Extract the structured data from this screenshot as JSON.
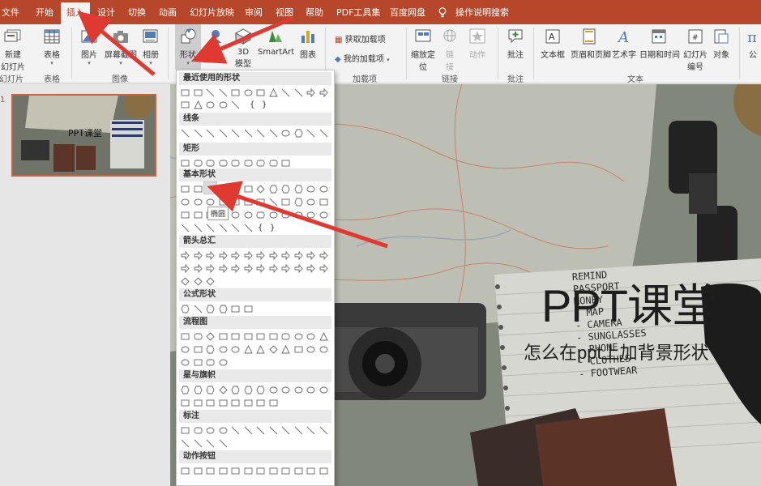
{
  "tabs": [
    "文件",
    "开始",
    "插入",
    "设计",
    "切换",
    "动画",
    "幻灯片放映",
    "审阅",
    "视图",
    "帮助",
    "PDF工具集",
    "百度网盘"
  ],
  "active_tab": "插入",
  "tell_me": "操作说明搜索",
  "ribbon": {
    "new_slide": "新建",
    "new_slide_2": "幻灯片",
    "table": "表格",
    "picture": "图片",
    "screenshot": "屏幕截图",
    "album": "相册",
    "shapes": "形状",
    "icons": "标",
    "model3d": "3D",
    "model3d_2": "模型",
    "smartart": "SmartArt",
    "chart": "图表",
    "get_addins": "获取加载项",
    "my_addins": "我的加载项",
    "zoom": "缩放定",
    "zoom_2": "位",
    "link": "链",
    "link_2": "接",
    "action": "动作",
    "comment": "批注",
    "textbox": "文本框",
    "header_footer": "页眉和页脚",
    "wordart": "艺术字",
    "datetime": "日期和时间",
    "slide_number": "幻灯片",
    "slide_number_2": "编号",
    "object": "对象",
    "formula": "公",
    "groups": {
      "slides": "幻灯片",
      "table": "表格",
      "images": "图像",
      "addins": "加载项",
      "links": "链接",
      "comments": "批注",
      "text": "文本"
    }
  },
  "shapes_menu": {
    "sections": [
      "最近使用的形状",
      "线条",
      "矩形",
      "基本形状",
      "箭头总汇",
      "公式形状",
      "流程图",
      "星与旗帜",
      "标注",
      "动作按钮"
    ],
    "tooltip": "椭圆",
    "glyphs": [
      "{",
      "}"
    ]
  },
  "thumbnail": {
    "number": "1",
    "title": "PPT课堂"
  },
  "slide": {
    "title": "PPT课堂",
    "subtitle": "怎么在ppt上加背景形状",
    "notebook_words": [
      "REMIND",
      "PASSPORT",
      "MONEY",
      "MAP",
      "CAMERA",
      "SUNGLASSES",
      "PHONE",
      "CLOTHES",
      "FOOTWEAR"
    ]
  },
  "colors": {
    "accent": "#b7472a",
    "arrow": "#e0392f"
  }
}
